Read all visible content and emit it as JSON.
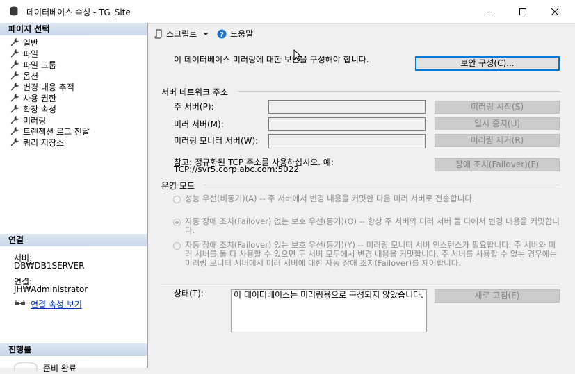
{
  "window": {
    "title": "데이터베이스 속성 - TG_Site"
  },
  "left": {
    "select_page_header": "페이지 선택",
    "pages": [
      "일반",
      "파일",
      "파일 그룹",
      "옵션",
      "변경 내용 추적",
      "사용 권한",
      "확장 속성",
      "미러링",
      "트랜잭션 로그 전달",
      "쿼리 저장소"
    ],
    "connection": {
      "header": "연결",
      "server_label": "서버:",
      "server_value": "DB₩DB1SERVER",
      "connection_label": "연결:",
      "connection_value": "JH₩Administrator",
      "view_props_link": "연결 속성 보기"
    },
    "progress": {
      "header": "진행률",
      "status": "준비 완료"
    }
  },
  "toolbar": {
    "script_label": "스크립트",
    "help_label": "도움말"
  },
  "security": {
    "text": "이 데이터베이스 미러링에 대한 보안을 구성해야 합니다.",
    "configure_button": "보안 구성(C)..."
  },
  "network": {
    "header": "서버 네트워크 주소",
    "principal_label": "주 서버(P):",
    "mirror_label": "미러 서버(M):",
    "witness_label": "미러링 모니터 서버(W):",
    "principal_value": "",
    "mirror_value": "",
    "witness_value": "",
    "start_button": "미러링 시작(S)",
    "pause_button": "일시 중지(U)",
    "remove_button": "미러링 제거(R)",
    "failover_button": "장애 조치(Failover)(F)",
    "note_line1": "참고: 정규화된 TCP 주소를 사용하십시오. 예:",
    "note_line2": "TCP://svr5.corp.abc.com:5022"
  },
  "mode": {
    "header": "운영 모드",
    "options": [
      {
        "text": "성능 우선(비동기)(A) -- 주 서버에서 변경 내용을 커밋한 다음 미러 서버로 전송합니다.",
        "selected": false
      },
      {
        "text": "자동 장애 조치(Failover) 없는 보호 우선(동기)(O) -- 항상 주 서버와 미러 서버 둘 다에서 변경 내용을 커밋합니다.",
        "selected": true
      },
      {
        "text": "자동 장애 조치(Failover) 있는 보호 우선(동기)(Y) -- 미러링 모니터 서버 인스턴스가 필요합니다. 주 서버와 미러 서버를 둘 다 사용할 수 있으면 두 서버 모두에서 변경 내용을 커밋합니다. 주 서버를 사용할 수 없는 경우에는 미러링 모니터 서버에서 미러 서버에 대한 자동 장애 조치(Failover)를 제어합니다.",
        "selected": false
      }
    ]
  },
  "status": {
    "label": "상태(T):",
    "text": "이 데이터베이스는 미러링용으로 구성되지 않았습니다.",
    "refresh_button": "새로 고침(E)"
  },
  "colors": {
    "accent": "#0078d7",
    "link": "#0033cc",
    "section_header": "#c9d7ea"
  }
}
